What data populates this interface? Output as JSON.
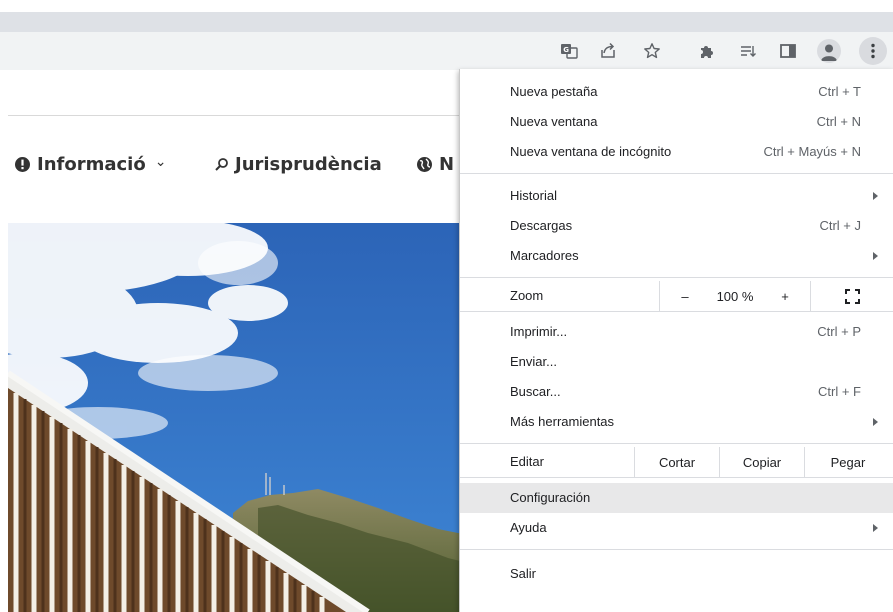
{
  "toolbar": {
    "icons": [
      "translate-icon",
      "share-icon",
      "bookmark-star-icon",
      "extensions-icon",
      "reading-list-icon",
      "side-panel-icon",
      "profile-icon",
      "menu-icon"
    ]
  },
  "site_nav": {
    "items": [
      {
        "icon": "info-circle-icon",
        "label": "Informació",
        "dropdown": true
      },
      {
        "icon": "search-icon",
        "label": "Jurisprudència"
      },
      {
        "icon": "globe-icon",
        "label": "N"
      }
    ],
    "dropdown_glyph": "⌄"
  },
  "menu": {
    "group1": [
      {
        "label": "Nueva pestaña",
        "shortcut": "Ctrl + T"
      },
      {
        "label": "Nueva ventana",
        "shortcut": "Ctrl + N"
      },
      {
        "label": "Nueva ventana de incógnito",
        "shortcut": "Ctrl + Mayús + N"
      }
    ],
    "group2": [
      {
        "label": "Historial"
      },
      {
        "label": "Descargas",
        "shortcut": "Ctrl + J"
      },
      {
        "label": "Marcadores"
      }
    ],
    "zoom": {
      "label": "Zoom",
      "minus": "–",
      "value": "100 %",
      "plus": "+"
    },
    "group3": [
      {
        "label": "Imprimir...",
        "shortcut": "Ctrl + P"
      },
      {
        "label": "Enviar..."
      },
      {
        "label": "Buscar...",
        "shortcut": "Ctrl + F"
      },
      {
        "label": "Más herramientas"
      }
    ],
    "edit": {
      "label": "Editar",
      "cut": "Cortar",
      "copy": "Copiar",
      "paste": "Pegar"
    },
    "group4": [
      {
        "label": "Configuración",
        "highlighted": true
      },
      {
        "label": "Ayuda"
      }
    ],
    "exit": {
      "label": "Salir"
    }
  },
  "colors": {
    "sky": "#2f6fc3",
    "menu_highlight": "#e8e8e9",
    "toolbar_bg": "#f1f3f4",
    "tab_band": "#dee1e6"
  }
}
